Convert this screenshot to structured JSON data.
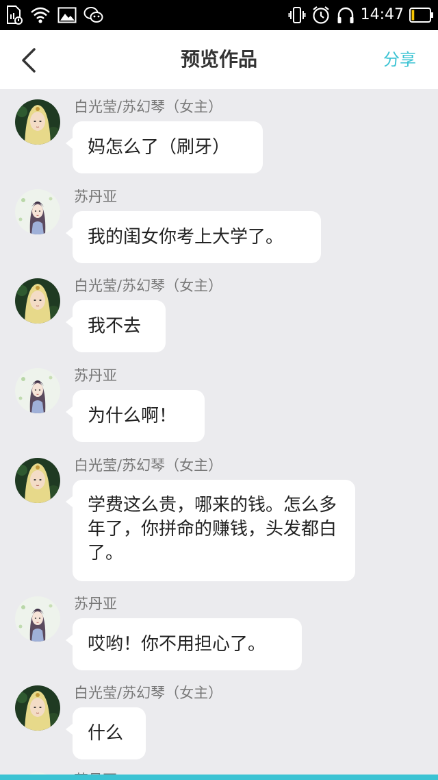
{
  "status_bar": {
    "time": "14:47",
    "icons": [
      "sim-file-icon",
      "wifi-icon",
      "image-icon",
      "wechat-icon",
      "vibrate-icon",
      "alarm-icon",
      "headphones-icon",
      "battery-icon"
    ],
    "battery_level": 0.15
  },
  "header": {
    "title": "预览作品",
    "share_label": "分享",
    "accent_color": "#3bc3d3"
  },
  "messages": [
    {
      "sender": "白光莹/苏幻琴（女主）",
      "avatar": "blonde-heroine",
      "text": "妈怎么了（刷牙）"
    },
    {
      "sender": "苏丹亚",
      "avatar": "dark-haired-woman",
      "text": "我的闺女你考上大学了。"
    },
    {
      "sender": "白光莹/苏幻琴（女主）",
      "avatar": "blonde-heroine",
      "text": "我不去"
    },
    {
      "sender": "苏丹亚",
      "avatar": "dark-haired-woman",
      "text": "为什么啊！"
    },
    {
      "sender": "白光莹/苏幻琴（女主）",
      "avatar": "blonde-heroine",
      "text": "学费这么贵，哪来的钱。怎么多年了，你拼命的赚钱，头发都白了。"
    },
    {
      "sender": "苏丹亚",
      "avatar": "dark-haired-woman",
      "text": "哎哟！你不用担心了。"
    },
    {
      "sender": "白光莹/苏幻琴（女主）",
      "avatar": "blonde-heroine",
      "text": "什么"
    },
    {
      "sender": "苏丹亚",
      "avatar": "dark-haired-woman",
      "text": ""
    }
  ]
}
